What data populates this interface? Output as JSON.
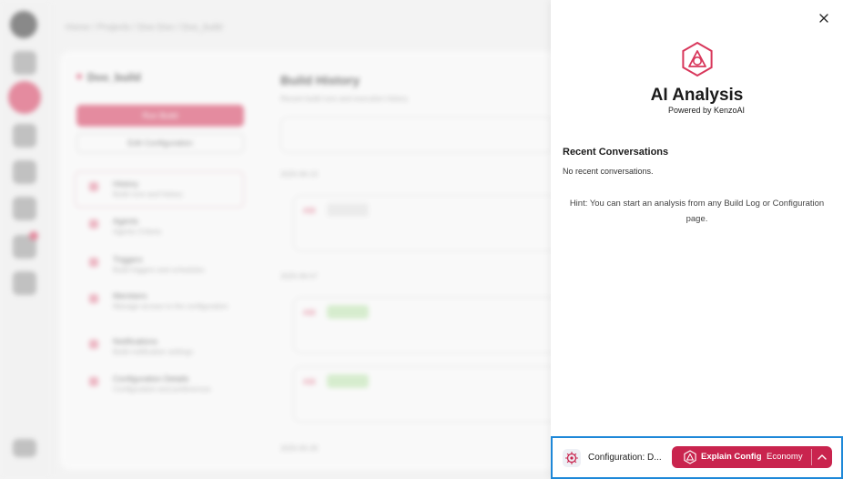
{
  "background": {
    "breadcrumb": "Home / Projects / Doo Doo / Doo_build",
    "config_name": "Doo_build",
    "run_button": "Run Build",
    "edit_button": "Edit Configuration",
    "nav": [
      {
        "title": "History",
        "sub": "Build runs and history"
      },
      {
        "title": "Agents",
        "sub": "Agents Criteria"
      },
      {
        "title": "Triggers",
        "sub": "Build triggers and schedules"
      },
      {
        "title": "Members",
        "sub": "Manage access to the configuration"
      },
      {
        "title": "Notifications",
        "sub": "Build notification settings"
      },
      {
        "title": "Configuration Details",
        "sub": "Configuration and preferences"
      }
    ],
    "main_title": "Build History",
    "main_sub": "Recent build runs and execution history",
    "dates": [
      "2025-06-13",
      "2025-06-07",
      "2025-05-29"
    ],
    "runs": [
      {
        "id": "#15",
        "status": "Canceled"
      },
      {
        "id": "#15",
        "status": "Completed"
      },
      {
        "id": "#15",
        "status": "Completed"
      }
    ]
  },
  "panel": {
    "title": "AI Analysis",
    "powered_by": "Powered by KenzoAI",
    "recent_heading": "Recent Conversations",
    "recent_empty": "No recent conversations.",
    "hint": "Hint: You can start an analysis from any Build Log or Configuration page.",
    "close_icon": "close-icon",
    "accent_color": "#c9244e"
  },
  "footer": {
    "context_label": "Configuration: D...",
    "explain_label": "Explain Config",
    "mode_label": "Economy",
    "highlight_color": "#1e88d8"
  }
}
